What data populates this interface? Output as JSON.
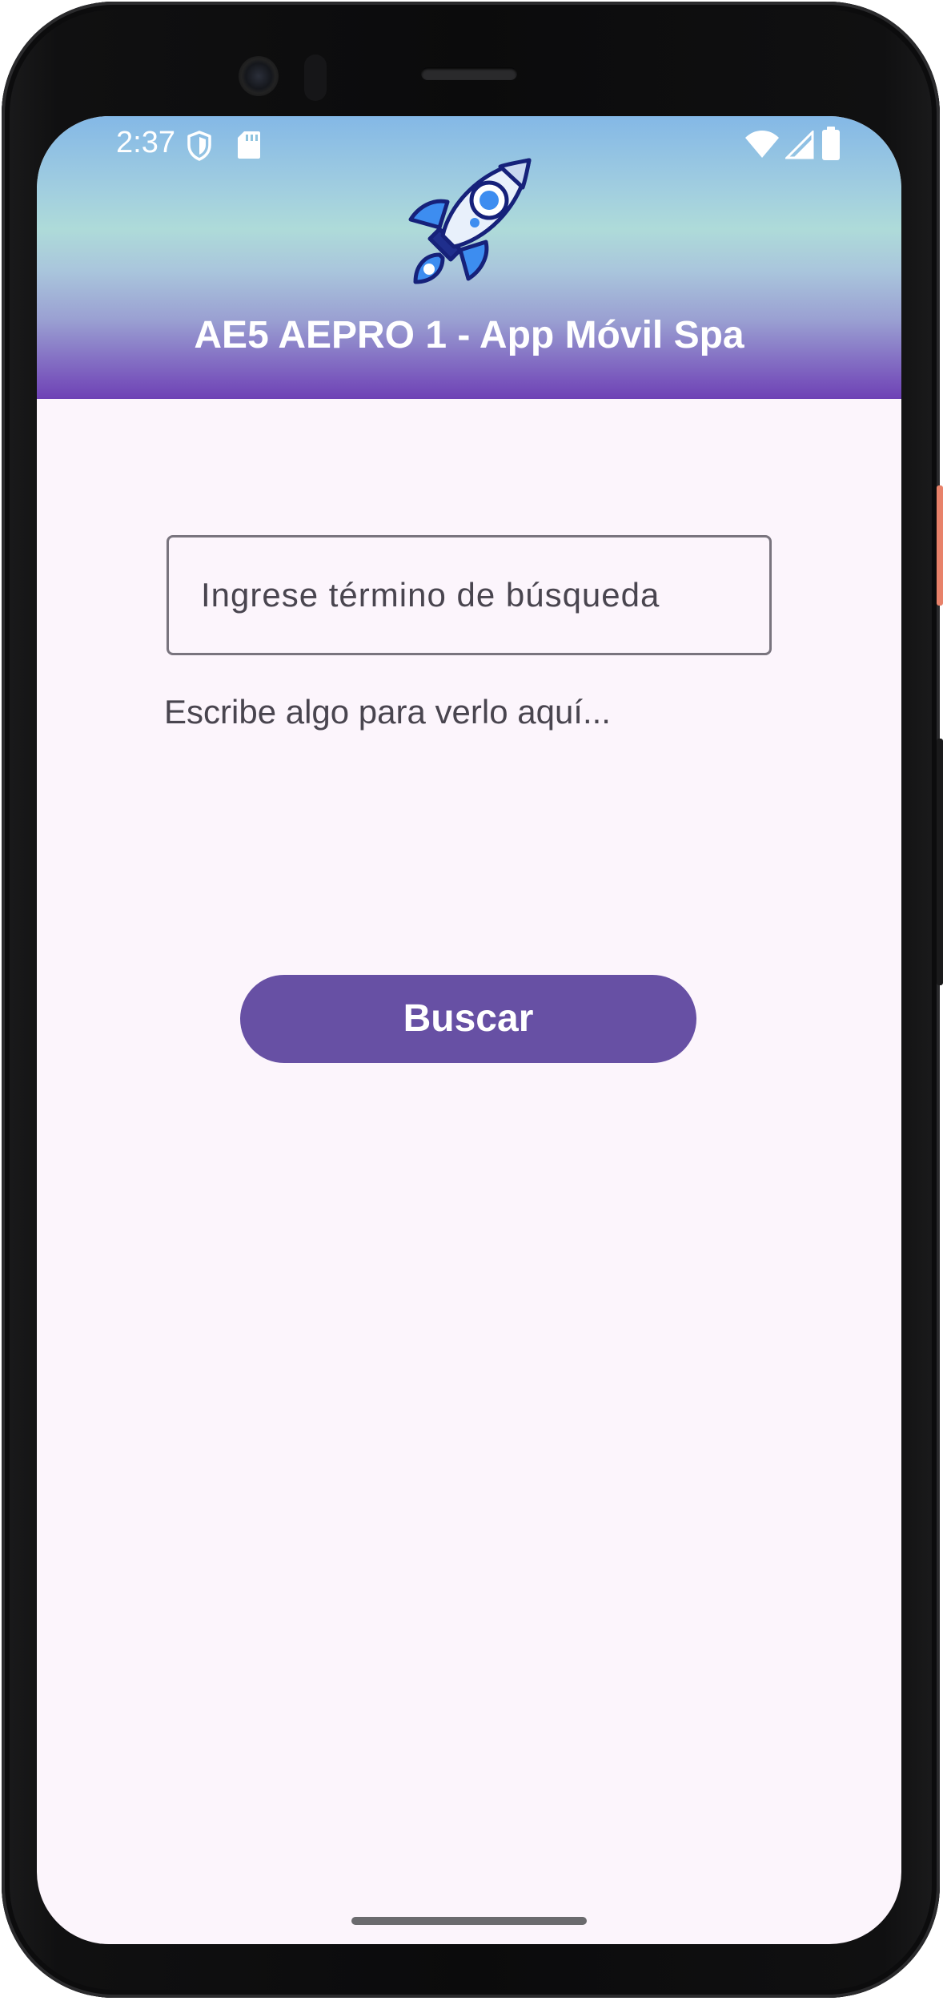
{
  "status_bar": {
    "time": "2:37",
    "icons": [
      "shield-icon",
      "sd-card-icon",
      "wifi-icon",
      "signal-icon",
      "battery-icon"
    ]
  },
  "header": {
    "logo": "rocket-icon",
    "title": "AE5 AEPRO 1 - App Móvil Spa"
  },
  "search": {
    "placeholder": "Ingrese término de búsqueda",
    "value": ""
  },
  "result": {
    "text": "Escribe algo para verlo aquí..."
  },
  "actions": {
    "search_label": "Buscar"
  },
  "colors": {
    "primary": "#6750a4",
    "background": "#fcf5fc",
    "header_top": "#84b8e6",
    "header_bottom": "#6e41b5",
    "text_secondary": "#49454f"
  }
}
